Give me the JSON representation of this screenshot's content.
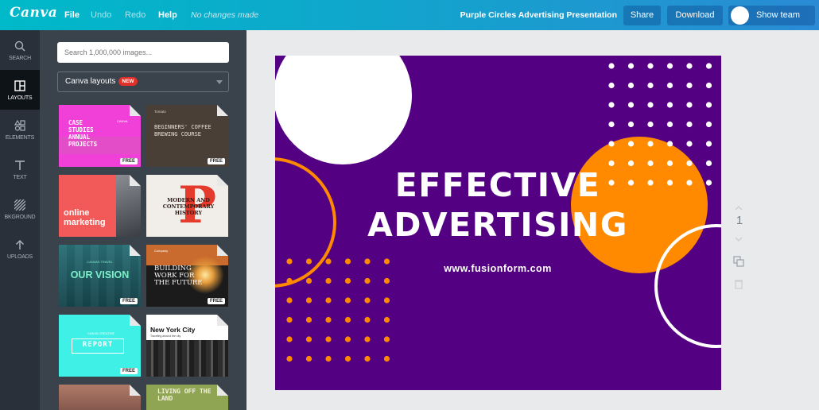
{
  "topbar": {
    "logo": "Canva",
    "menu": [
      "File",
      "Undo",
      "Redo",
      "Help"
    ],
    "status": "No changes made",
    "document_title": "Purple Circles Advertising Presentation",
    "share_label": "Share",
    "download_label": "Download",
    "show_team_label": "Show team"
  },
  "rail": {
    "items": [
      {
        "label": "SEARCH",
        "icon": "search-icon"
      },
      {
        "label": "LAYOUTS",
        "icon": "layouts-icon",
        "active": true
      },
      {
        "label": "ELEMENTS",
        "icon": "elements-icon"
      },
      {
        "label": "TEXT",
        "icon": "text-icon"
      },
      {
        "label": "BKGROUND",
        "icon": "background-icon"
      },
      {
        "label": "UPLOADS",
        "icon": "upload-icon"
      }
    ]
  },
  "panel": {
    "search_placeholder": "Search 1,000,000 images...",
    "layouts_label": "Canva layouts",
    "new_badge": "NEW",
    "free_badge": "FREE",
    "thumbs": {
      "t1": {
        "text": "CASE\nSTUDIES\nANNUAL\nPROJECTS",
        "sub": "CANVA"
      },
      "t2": {
        "text": "BEGINNERS' COFFEE\nBREWING COURSE",
        "small": "Tomato"
      },
      "t3": {
        "text": "online\nmarketing"
      },
      "t4": {
        "big": "P",
        "text": "MODERN AND\nCONTEMPORARY\nHISTORY"
      },
      "t5": {
        "text": "OUR VISION",
        "small": "CANVAS TRAVEL"
      },
      "t6": {
        "text": "BUILDING\nWORK FOR\nTHE FUTURE",
        "small": "Company"
      },
      "t7": {
        "text": "REPORT",
        "small": "CANVA CREATIVE"
      },
      "t8": {
        "text": "New York City",
        "small": "Traveling around the city"
      },
      "t10": {
        "text": "LIVING OFF THE LAND"
      }
    }
  },
  "canvas": {
    "headline_1": "EFFECTIVE",
    "headline_2": "ADVERTISING",
    "url": "www.fusionform.com",
    "colors": {
      "background": "#540083",
      "orange": "#ff8a00",
      "white": "#ffffff"
    }
  },
  "side_tools": {
    "page_number": "1"
  }
}
